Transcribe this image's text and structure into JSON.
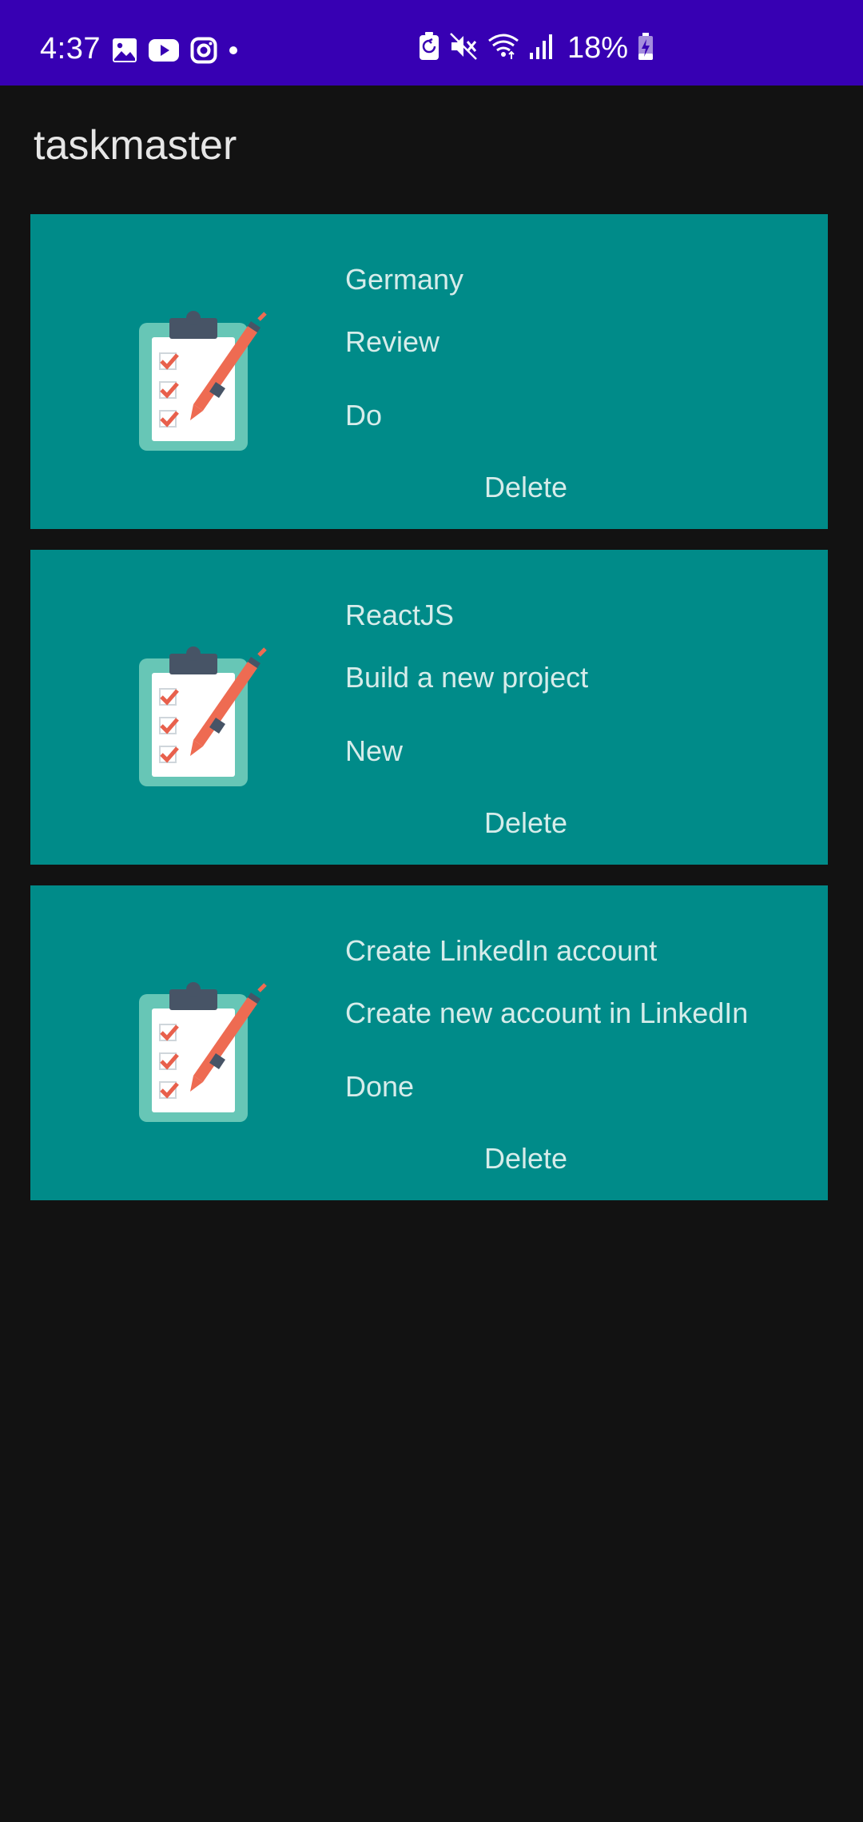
{
  "status_bar": {
    "time": "4:37",
    "left_icons": [
      "gallery-icon",
      "youtube-icon",
      "instagram-icon",
      "dot-icon"
    ],
    "right_icons": [
      "battery-saver-icon",
      "mute-icon",
      "wifi-icon",
      "signal-icon",
      "battery-charging-icon"
    ],
    "battery": "18%",
    "background": "#3700b3"
  },
  "app": {
    "title": "taskmaster",
    "background": "#121212"
  },
  "tasks": [
    {
      "title": "Germany",
      "body": "Review",
      "state": "Do",
      "delete_label": "Delete",
      "image": "clipboard-checklist-icon"
    },
    {
      "title": "ReactJS",
      "body": "Build a new project",
      "state": "New",
      "delete_label": "Delete",
      "image": "clipboard-checklist-icon"
    },
    {
      "title": "Create LinkedIn account",
      "body": "Create new account in LinkedIn",
      "state": "Done",
      "delete_label": "Delete",
      "image": "clipboard-checklist-icon"
    }
  ],
  "colors": {
    "card": "#008b89",
    "card_text": "#d6ecea",
    "clipboard_board": "#67c6b6",
    "clipboard_clip": "#475466",
    "check": "#e8604c",
    "pen": "#ee6b52"
  }
}
